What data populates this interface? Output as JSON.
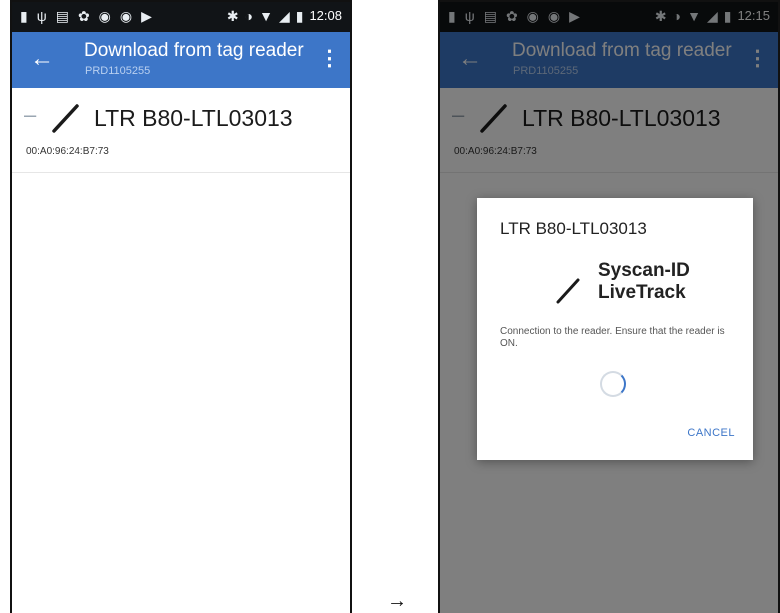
{
  "colors": {
    "accent": "#3d76c8",
    "status_bar": "#111417",
    "dim": "rgba(0,0,0,0.5)"
  },
  "status_bar": {
    "left_icons": [
      "notification-icon",
      "usb-icon",
      "message-icon",
      "app-icon",
      "wifi-icon",
      "wifi-icon",
      "play-icon"
    ],
    "right_icons": [
      "bluetooth-icon",
      "mute-icon",
      "wifi-signal-icon",
      "cell-signal-icon",
      "battery-icon"
    ]
  },
  "screen_before": {
    "status_time": "12:08",
    "app_bar": {
      "title": "Download from tag reader",
      "subtitle": "PRD1105255"
    },
    "device": {
      "name": "LTR B80-LTL03013",
      "mac": "00:A0:96:24:B7:73"
    }
  },
  "screen_after": {
    "status_time": "12:15",
    "app_bar": {
      "title": "Download from tag reader",
      "subtitle": "PRD1105255"
    },
    "device": {
      "name": "LTR B80-LTL03013",
      "mac": "00:A0:96:24:B7:73"
    },
    "dialog": {
      "title": "LTR B80-LTL03013",
      "brand_line1": "Syscan-ID",
      "brand_line2": "LiveTrack",
      "message": "Connection to the reader. Ensure that the reader is ON.",
      "cancel_label": "CANCEL"
    }
  },
  "arrow": "→"
}
